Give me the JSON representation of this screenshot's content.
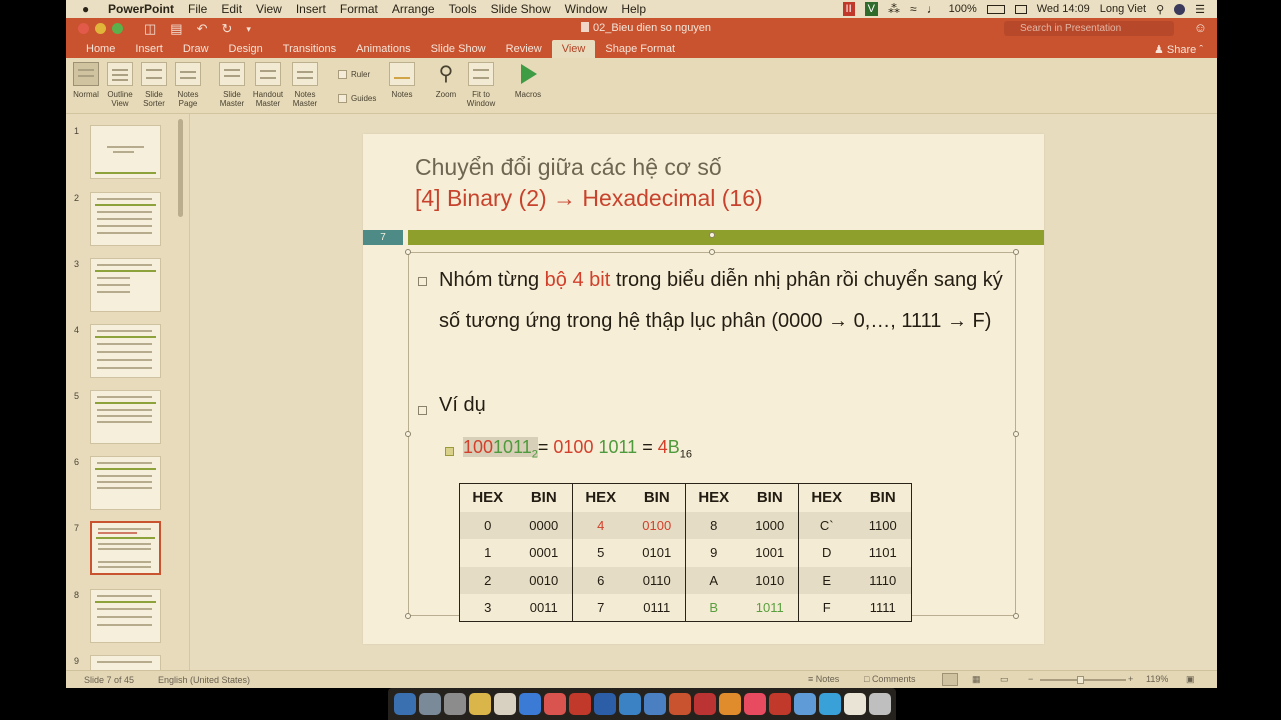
{
  "menubar": {
    "app": "PowerPoint",
    "items": [
      "File",
      "Edit",
      "View",
      "Insert",
      "Format",
      "Arrange",
      "Tools",
      "Slide Show",
      "Window",
      "Help"
    ],
    "battery": "100%",
    "clock": "Wed 14:09",
    "user": "Long Viet"
  },
  "titlebar": {
    "doc_title": "02_Bieu dien so nguyen",
    "search_placeholder": "Search in Presentation"
  },
  "ribbon": {
    "tabs": [
      "Home",
      "Insert",
      "Draw",
      "Design",
      "Transitions",
      "Animations",
      "Slide Show",
      "Review",
      "View",
      "Shape Format"
    ],
    "active_tab": "View",
    "share_label": "Share",
    "buttons": {
      "normal": "Normal",
      "outline": "Outline View",
      "sorter": "Slide Sorter",
      "notes_page": "Notes Page",
      "slide_master": "Slide Master",
      "handout_master": "Handout Master",
      "notes_master": "Notes Master",
      "ruler": "Ruler",
      "guides": "Guides",
      "notes": "Notes",
      "zoom": "Zoom",
      "fit": "Fit to Window",
      "macros": "Macros"
    }
  },
  "thumbnails": {
    "numbers": [
      "1",
      "2",
      "3",
      "4",
      "5",
      "6",
      "7",
      "8",
      "9"
    ],
    "selected": "7"
  },
  "slide": {
    "title_line1": "Chuyển đổi giữa các hệ cơ số",
    "title_line2": "[4]  Binary (2) → Hexadecimal (16)",
    "slide_number": "7",
    "para1_a": "Nhóm từng ",
    "para1_red": "bộ 4 bit",
    "para1_b": " trong biểu diễn nhị phân rồi chuyển sang ký số tương ứng trong hệ thập lục phân (0000 → 0,…, 1111 → F)",
    "para2": "Ví dụ",
    "example": {
      "bin_red": "100",
      "bin_green": "1011",
      "bin_sub": "2",
      "eq1": "= ",
      "grp_red": "0100",
      "grp_green": "1011",
      "eq2": " = ",
      "hex_red": "4",
      "hex_green": "B",
      "hex_sub": "16"
    },
    "table": {
      "headers": [
        "HEX",
        "BIN",
        "HEX",
        "BIN",
        "HEX",
        "BIN",
        "HEX",
        "BIN"
      ],
      "rows": [
        [
          "0",
          "0000",
          "4",
          "0100",
          "8",
          "1000",
          "C`",
          "1100"
        ],
        [
          "1",
          "0001",
          "5",
          "0101",
          "9",
          "1001",
          "D",
          "1101"
        ],
        [
          "2",
          "0010",
          "6",
          "0110",
          "A",
          "1010",
          "E",
          "1110"
        ],
        [
          "3",
          "0011",
          "7",
          "0111",
          "B",
          "1011",
          "F",
          "1111"
        ]
      ]
    }
  },
  "statusbar": {
    "slide_info": "Slide 7 of 45",
    "language": "English (United States)",
    "notes": "Notes",
    "comments": "Comments",
    "zoom": "119%"
  },
  "colors": {
    "accent": "#c9522f",
    "red_text": "#d2402c",
    "green_text": "#4e9a3c",
    "slide_bar": "#8e9f2c"
  }
}
